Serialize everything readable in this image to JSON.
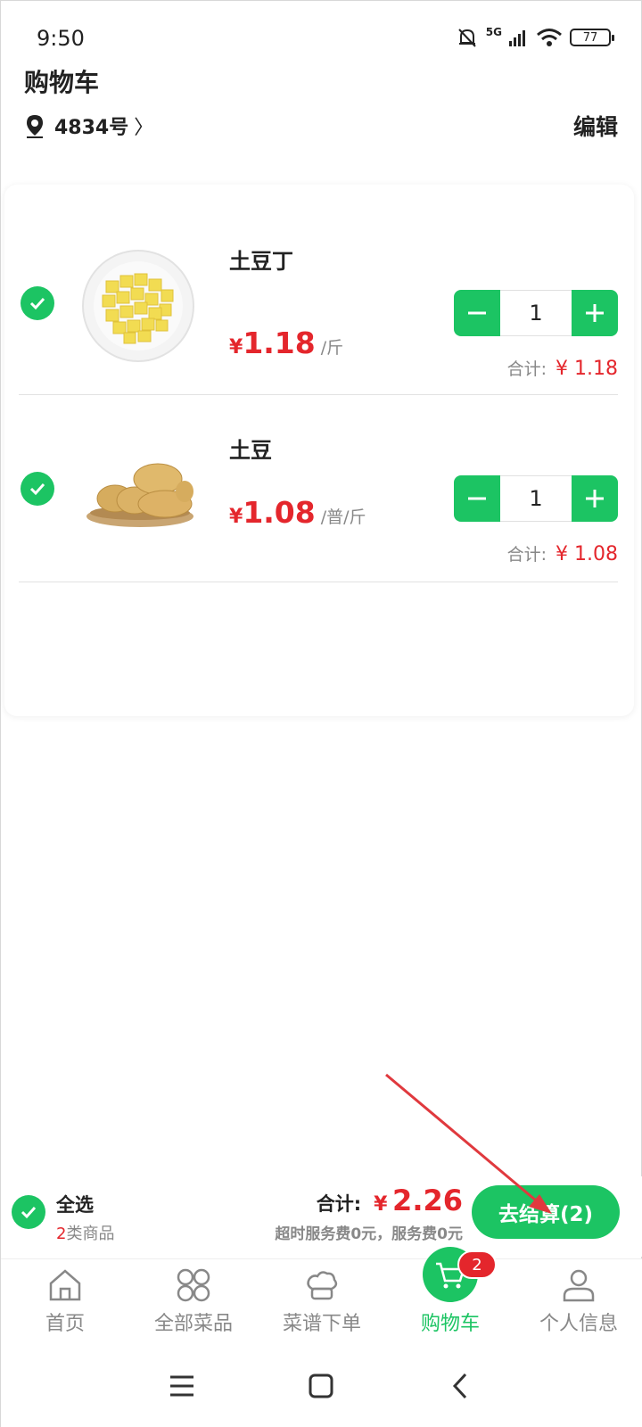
{
  "status_bar": {
    "time": "9:50",
    "network": "5G",
    "battery": "77"
  },
  "header": {
    "title": "购物车",
    "location": "4834号",
    "edit_label": "编辑"
  },
  "cart_items": [
    {
      "name": "土豆丁",
      "currency": "¥",
      "price": "1.18",
      "unit": "/斤",
      "quantity": "1",
      "subtotal_label": "合计:",
      "subtotal": "¥ 1.18",
      "checked": true,
      "thumb_icon": "diced-potato-image"
    },
    {
      "name": "土豆",
      "currency": "¥",
      "price": "1.08",
      "unit": "/普/斤",
      "quantity": "1",
      "subtotal_label": "合计:",
      "subtotal": "¥ 1.08",
      "checked": true,
      "thumb_icon": "potato-image"
    }
  ],
  "checkout": {
    "select_all_label": "全选",
    "category_count": "2",
    "category_suffix": "类商品",
    "total_label": "合计:",
    "currency": "¥",
    "total": "2.26",
    "fee_note": "超时服务费0元，服务费0元",
    "button_label": "去结算(2)"
  },
  "tabs": [
    {
      "label": "首页",
      "icon": "home-icon",
      "active": false
    },
    {
      "label": "全部菜品",
      "icon": "grid-icon",
      "active": false
    },
    {
      "label": "菜谱下单",
      "icon": "chef-hat-icon",
      "active": false
    },
    {
      "label": "购物车",
      "icon": "cart-icon",
      "active": true,
      "badge": "2"
    },
    {
      "label": "个人信息",
      "icon": "person-icon",
      "active": false
    }
  ],
  "colors": {
    "accent": "#1cc463",
    "price": "#e4262c",
    "annotation": "#e0393e"
  }
}
